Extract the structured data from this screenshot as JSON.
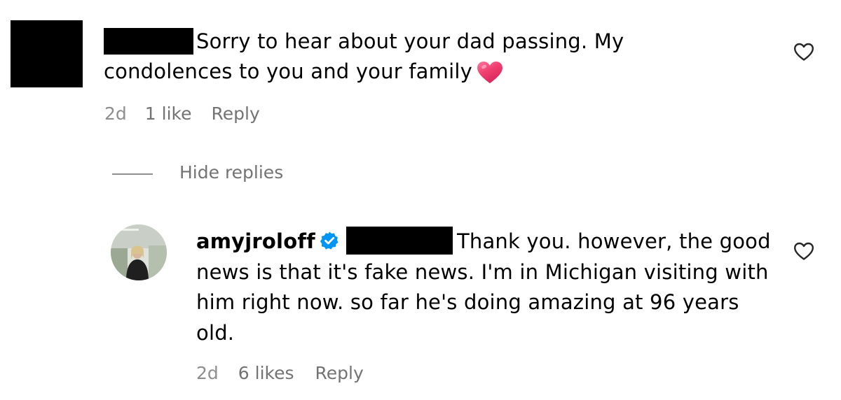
{
  "comment": {
    "text": "Sorry to hear about your dad passing. My condolences to you and your family",
    "emoji": "red-heart-emoji",
    "time": "2d",
    "likes": "1 like",
    "reply_label": "Reply"
  },
  "thread": {
    "toggle_label": "Hide replies"
  },
  "reply": {
    "username": "amyjroloff",
    "verified": true,
    "text": "Thank you. however, the good news is that it's fake news. I'm in Michigan visiting with him right now. so far he's doing amazing at 96 years old.",
    "time": "2d",
    "likes": "6 likes",
    "reply_label": "Reply"
  },
  "colors": {
    "meta": "#737373",
    "verified_badge": "#0095f6",
    "emoji_heart": "#e8386a"
  }
}
